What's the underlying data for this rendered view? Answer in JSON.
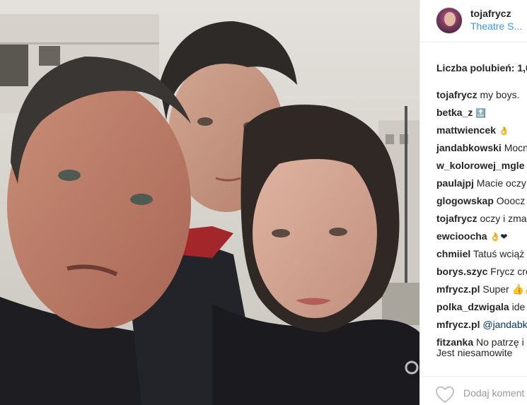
{
  "post": {
    "username": "tojafrycz",
    "location": "Theatre S...",
    "likes_label": "Liczba polubień: 1,0"
  },
  "comments": [
    {
      "user": "tojafrycz",
      "text": "my boys."
    },
    {
      "user": "betka_z",
      "text": "🔝"
    },
    {
      "user": "mattwiencek",
      "text": "👌"
    },
    {
      "user": "jandabkowski",
      "text": "Mocn"
    },
    {
      "user": "w_kolorowej_mgle",
      "text": ""
    },
    {
      "user": "paulajpj",
      "text": "Macie oczy"
    },
    {
      "user": "glogowskap",
      "text": "Ooocz"
    },
    {
      "user": "tojafrycz",
      "text": "oczy i zma"
    },
    {
      "user": "ewcioocha",
      "text": "👌❤"
    },
    {
      "user": "chmiiel",
      "text": "Tatuś wciąż"
    },
    {
      "user": "borys.szyc",
      "text": "Frycz cre"
    },
    {
      "user": "mfrycz.pl",
      "text": "Super 👍👍"
    },
    {
      "user": "polka_dzwigala",
      "text": "ide"
    },
    {
      "user": "mfrycz.pl",
      "text": "@jandabk",
      "mention": true
    },
    {
      "user": "fitzanka",
      "text": "No patrzę i"
    }
  ],
  "comment_overflow": "Jest niesamowite",
  "footer": {
    "add_comment_placeholder": "Dodaj koment"
  },
  "icons": {
    "heart": "heart-outline-icon"
  },
  "colors": {
    "link": "#3897f0",
    "text": "#262626",
    "muted": "#999999"
  }
}
